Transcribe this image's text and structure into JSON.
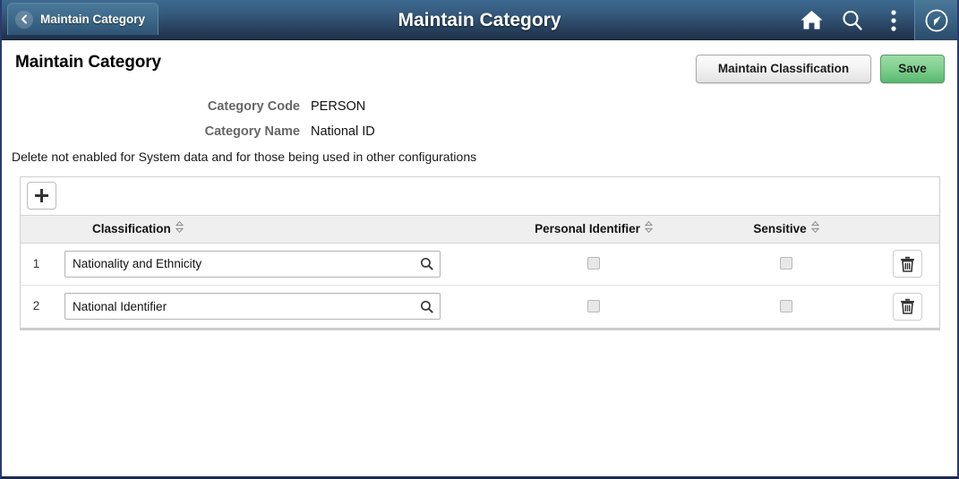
{
  "header": {
    "back_label": "Maintain Category",
    "back_icon": "chevron-left-icon",
    "title": "Maintain Category",
    "icons": {
      "home": "home-icon",
      "search": "search-icon",
      "actions": "three-dot-actions-icon",
      "navbar": "compass-navbar-icon"
    }
  },
  "page": {
    "title": "Maintain Category",
    "buttons": {
      "maintain_classification": "Maintain Classification",
      "save": "Save"
    },
    "fields": [
      {
        "label": "Category Code",
        "value": "PERSON"
      },
      {
        "label": "Category Name",
        "value": "National ID"
      }
    ],
    "note": "Delete not enabled for System data and for those being used in other configurations"
  },
  "grid": {
    "add_button_label": "+",
    "add_button_icon": "plus-icon",
    "columns": [
      {
        "key": "classification",
        "label": "Classification",
        "sortable": true
      },
      {
        "key": "personal_identifier",
        "label": "Personal Identifier",
        "sortable": true
      },
      {
        "key": "sensitive",
        "label": "Sensitive",
        "sortable": true
      }
    ],
    "rows": [
      {
        "num": "1",
        "classification": "Nationality and Ethnicity",
        "classification_placeholder": "",
        "personal_identifier": false,
        "sensitive": false,
        "lookup_icon": "search-lookup-icon",
        "delete_icon": "trash-icon"
      },
      {
        "num": "2",
        "classification": "National Identifier",
        "classification_placeholder": "",
        "personal_identifier": false,
        "sensitive": false,
        "lookup_icon": "search-lookup-icon",
        "delete_icon": "trash-icon"
      }
    ]
  },
  "colors": {
    "header_top": "#3d6a91",
    "header_bottom": "#1f3049",
    "save_green": "#7ccd8c",
    "grid_header_bg": "#efefef",
    "page_border": "#2a3b6e"
  }
}
